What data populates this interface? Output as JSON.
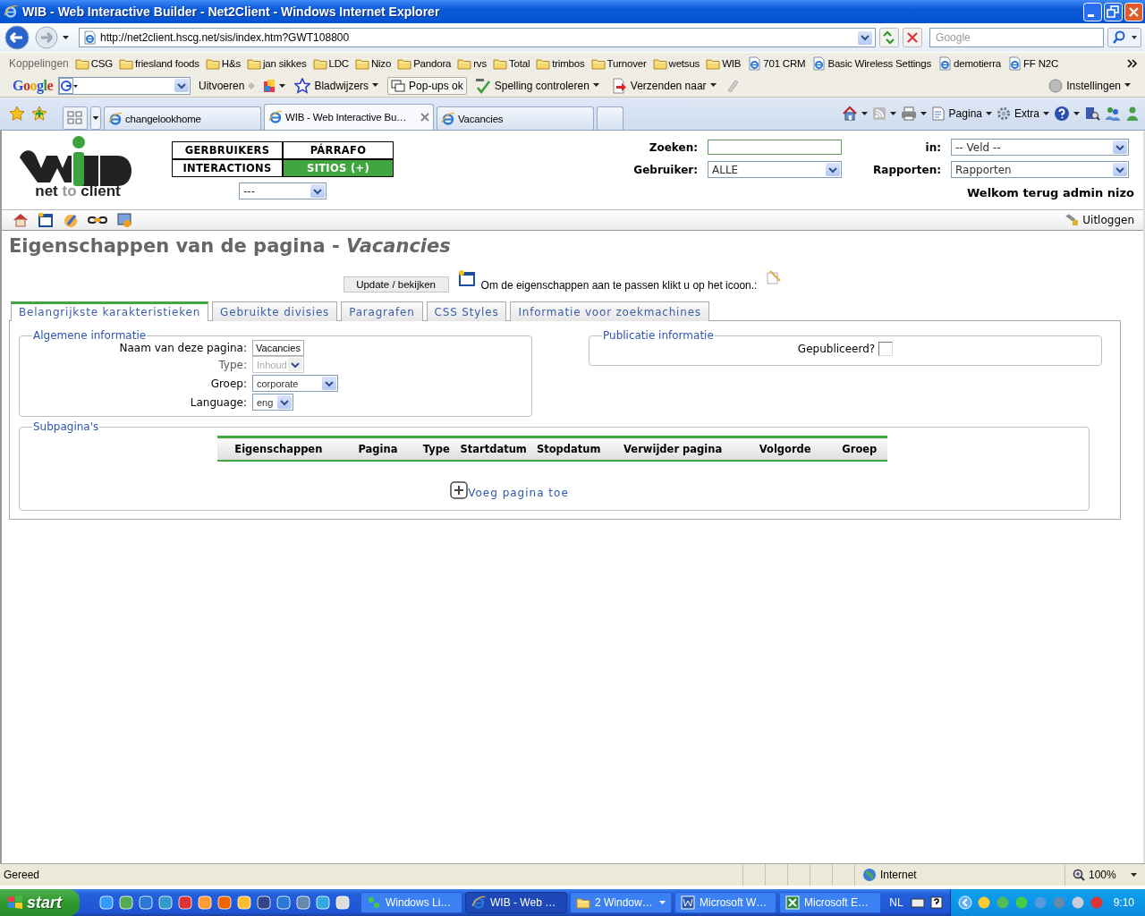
{
  "window": {
    "title": "WIB - Web Interactive Builder - Net2Client - Windows Internet Explorer"
  },
  "address_bar": {
    "url": "http://net2client.hscg.net/sis/index.htm?GWT108800",
    "search_placeholder": "Google"
  },
  "links_bar": {
    "label": "Koppelingen",
    "items": [
      {
        "label": "CSG",
        "kind": "folder"
      },
      {
        "label": "friesland foods",
        "kind": "folder"
      },
      {
        "label": "H&s",
        "kind": "folder"
      },
      {
        "label": "jan sikkes",
        "kind": "folder"
      },
      {
        "label": "LDC",
        "kind": "folder"
      },
      {
        "label": "Nizo",
        "kind": "folder"
      },
      {
        "label": "Pandora",
        "kind": "folder"
      },
      {
        "label": "rvs",
        "kind": "folder"
      },
      {
        "label": "Total",
        "kind": "folder"
      },
      {
        "label": "trimbos",
        "kind": "folder"
      },
      {
        "label": "Turnover",
        "kind": "folder"
      },
      {
        "label": "wetsus",
        "kind": "folder"
      },
      {
        "label": "WIB",
        "kind": "folder"
      },
      {
        "label": "701 CRM",
        "kind": "page"
      },
      {
        "label": "Basic Wireless Settings",
        "kind": "page"
      },
      {
        "label": "demotierra",
        "kind": "page"
      },
      {
        "label": "FF  N2C",
        "kind": "page"
      }
    ]
  },
  "google_toolbar": {
    "logo": "Google",
    "run": "Uitvoeren",
    "bookmarks": "Bladwijzers",
    "popups": "Pop-ups ok",
    "spelling": "Spelling controleren",
    "send": "Verzenden naar",
    "settings": "Instellingen"
  },
  "browser_tabs": [
    {
      "label": "changelookhome",
      "selected": false
    },
    {
      "label": "WIB - Web Interactive Bu…",
      "selected": true
    },
    {
      "label": "Vacancies",
      "selected": false
    }
  ],
  "command_bar": {
    "page": "Pagina",
    "extra": "Extra"
  },
  "site_header": {
    "logo_words": [
      "net",
      "to",
      "client"
    ],
    "nav_menu": [
      {
        "label": "GERBRUIKERS",
        "selected": false
      },
      {
        "label": "PÁRRAFO",
        "selected": false
      },
      {
        "label": "INTERACTIONS",
        "selected": false
      },
      {
        "label": "SITIOS (+)",
        "selected": true
      }
    ],
    "nav_select": "---",
    "search_label": "Zoeken:",
    "in_label": "in:",
    "in_value": "-- Veld --",
    "user_label": "Gebruiker:",
    "user_value": "ALLE",
    "reports_label": "Rapporten:",
    "reports_value": "Rapporten",
    "welcome": "Welkom terug admin nizo"
  },
  "logout": "Uitloggen",
  "page_title": "Eigenschappen van de pagina - *Vacancies*",
  "update_button": "Update / bekijken",
  "hint": "Om de eigenschappen aan te passen klikt u op het icoon.:",
  "tabs": [
    {
      "label": "Belangrijkste karakteristieken",
      "selected": true
    },
    {
      "label": "Gebruikte divisies",
      "selected": false
    },
    {
      "label": "Paragrafen",
      "selected": false
    },
    {
      "label": "CSS Styles",
      "selected": false
    },
    {
      "label": "Informatie voor zoekmachines",
      "selected": false
    }
  ],
  "general_info": {
    "legend": "Algemene informatie",
    "fields": [
      {
        "label": "Naam van deze pagina:",
        "kind": "text",
        "value": "Vacancies",
        "disabled": false
      },
      {
        "label": "Type:",
        "kind": "select",
        "value": "Inhoud",
        "disabled": true
      },
      {
        "label": "Groep:",
        "kind": "select",
        "value": "corporate",
        "disabled": false
      },
      {
        "label": "Language:",
        "kind": "select",
        "value": "eng",
        "disabled": false
      }
    ]
  },
  "publication": {
    "legend": "Publicatie informatie",
    "label": "Gepubliceerd?",
    "checked": false
  },
  "subpages": {
    "legend": "Subpagina's",
    "columns": [
      "Eigenschappen",
      "Pagina",
      "Type",
      "Startdatum",
      "Stopdatum",
      "Verwijder pagina",
      "Volgorde",
      "Groep"
    ],
    "add_link": "Voeg pagina toe"
  },
  "status_bar": {
    "text": "Gereed",
    "zone": "Internet",
    "zoom": "100%"
  },
  "taskbar": {
    "start": "start",
    "tasks": [
      {
        "label": "Windows Li…",
        "selected": false
      },
      {
        "label": "WIB - Web …",
        "selected": true
      },
      {
        "label": "2 Window…",
        "selected": false
      },
      {
        "label": "Microsoft W…",
        "selected": false
      },
      {
        "label": "Microsoft E…",
        "selected": false
      }
    ],
    "language": "NL",
    "clock": "9:10"
  }
}
